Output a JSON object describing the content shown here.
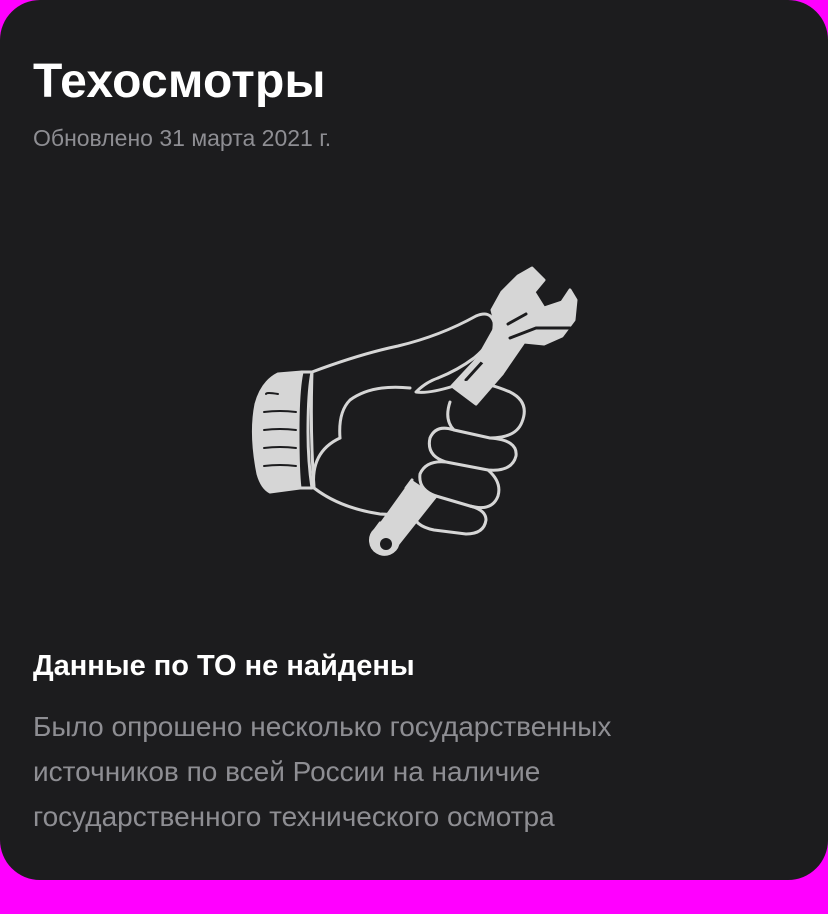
{
  "card": {
    "title": "Техосмотры",
    "updated": "Обновлено 31 марта 2021 г."
  },
  "illustration": {
    "icon": "hand-holding-wrench-icon"
  },
  "empty_state": {
    "title": "Данные по ТО не найдены",
    "description": "Было опрошено несколько государственных источников по всей России на наличие государственного технического осмотра"
  },
  "colors": {
    "card_background": "#1c1c1e",
    "page_background": "#ff00ff",
    "title": "#ffffff",
    "secondary_text": "#8e8e93",
    "illustration_fill": "#d6d6d6"
  }
}
